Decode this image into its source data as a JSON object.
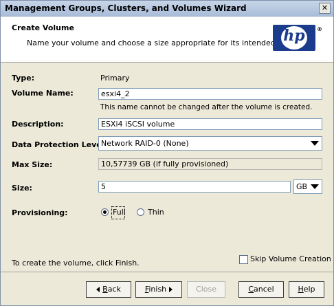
{
  "window": {
    "title": "Management Groups, Clusters, and Volumes Wizard",
    "close_glyph": "✕"
  },
  "header": {
    "title": "Create Volume",
    "subtitle": "Name your volume and choose a size appropriate for its intended use.",
    "logo_text": "hp",
    "logo_mark": "®"
  },
  "form": {
    "type": {
      "label": "Type:",
      "value": "Primary"
    },
    "volume_name": {
      "label": "Volume Name:",
      "value": "esxi4_2",
      "note": "This name cannot be changed after the volume is created."
    },
    "description": {
      "label": "Description:",
      "value": "ESXi4 iSCSI volume"
    },
    "protection": {
      "label": "Data Protection Level:",
      "selected": "Network RAID-0 (None)"
    },
    "max_size": {
      "label": "Max Size:",
      "value": "10,57739 GB (if fully provisioned)"
    },
    "size": {
      "label": "Size:",
      "value": "5",
      "unit": "GB"
    },
    "provisioning": {
      "label": "Provisioning:",
      "options": [
        "Full",
        "Thin"
      ],
      "selected": "Full"
    }
  },
  "footer": {
    "hint": "To create the volume, click Finish.",
    "skip_label": "Skip Volume Creation",
    "skip_checked": false
  },
  "buttons": {
    "back": {
      "prefix": "",
      "u": "B",
      "rest": "ack"
    },
    "finish": {
      "prefix": "",
      "u": "F",
      "rest": "inish"
    },
    "close": {
      "label": "Close"
    },
    "cancel": {
      "prefix": "",
      "u": "C",
      "rest": "ancel"
    },
    "help": {
      "prefix": "",
      "u": "H",
      "rest": "elp"
    }
  },
  "colors": {
    "hp_blue": "#1b3c8c",
    "dialog_bg": "#ece9d8"
  }
}
